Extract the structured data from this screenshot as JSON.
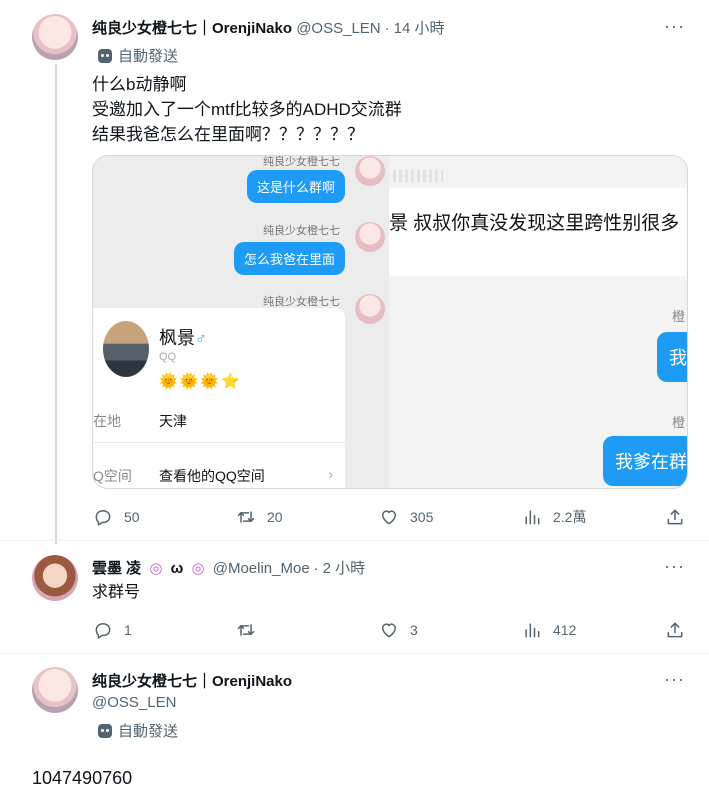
{
  "tweet1": {
    "display_name": "纯良少女橙七七｜OrenjiNako",
    "handle": "@OSS_LEN",
    "time": "14 小時",
    "auto_label": "自動發送",
    "lines": [
      "什么b动静啊",
      "受邀加入了一个mtf比较多的ADHD交流群",
      "结果我爸怎么在里面啊？？？？？？"
    ],
    "media": {
      "sender_name": "纯良少女橙七七",
      "bubble1": "这是什么群啊",
      "bubble2": "怎么我爸在里面",
      "right_big_text": "景 叔叔你真没发现这里跨性别很多",
      "right_sender1": "橙",
      "right_bubble1": "我",
      "right_sender2": "橙",
      "right_bubble2": "我爹在群",
      "card": {
        "name": "枫景",
        "gender_symbol": "♂",
        "qq_label": "QQ",
        "level_icons": "🌞🌞🌞⭐",
        "location_label": "在地",
        "location_value": "天津",
        "space_label": "Q空间",
        "space_value": "查看他的QQ空间",
        "arrow": "›"
      }
    },
    "stats": {
      "replies": "50",
      "retweets": "20",
      "likes": "305",
      "views": "2.2萬"
    }
  },
  "tweet2": {
    "display_name": "雲墨 凌",
    "name_suffix": "ω",
    "handle": "@Moelin_Moe",
    "time": "2 小時",
    "text": "求群号",
    "stats": {
      "replies": "1",
      "retweets": "",
      "likes": "3",
      "views": "412"
    }
  },
  "tweet3": {
    "display_name": "纯良少女橙七七｜OrenjiNako",
    "handle": "@OSS_LEN",
    "auto_label": "自動發送",
    "text": "1047490760"
  },
  "more_label": "···",
  "dot": "·"
}
